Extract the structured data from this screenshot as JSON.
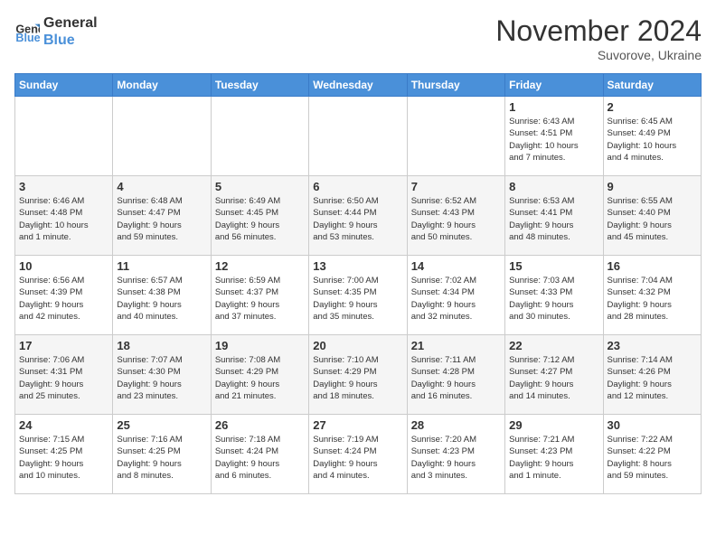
{
  "logo": {
    "line1": "General",
    "line2": "Blue"
  },
  "title": "November 2024",
  "location": "Suvorove, Ukraine",
  "days_of_week": [
    "Sunday",
    "Monday",
    "Tuesday",
    "Wednesday",
    "Thursday",
    "Friday",
    "Saturday"
  ],
  "weeks": [
    [
      {
        "day": "",
        "info": ""
      },
      {
        "day": "",
        "info": ""
      },
      {
        "day": "",
        "info": ""
      },
      {
        "day": "",
        "info": ""
      },
      {
        "day": "",
        "info": ""
      },
      {
        "day": "1",
        "info": "Sunrise: 6:43 AM\nSunset: 4:51 PM\nDaylight: 10 hours\nand 7 minutes."
      },
      {
        "day": "2",
        "info": "Sunrise: 6:45 AM\nSunset: 4:49 PM\nDaylight: 10 hours\nand 4 minutes."
      }
    ],
    [
      {
        "day": "3",
        "info": "Sunrise: 6:46 AM\nSunset: 4:48 PM\nDaylight: 10 hours\nand 1 minute."
      },
      {
        "day": "4",
        "info": "Sunrise: 6:48 AM\nSunset: 4:47 PM\nDaylight: 9 hours\nand 59 minutes."
      },
      {
        "day": "5",
        "info": "Sunrise: 6:49 AM\nSunset: 4:45 PM\nDaylight: 9 hours\nand 56 minutes."
      },
      {
        "day": "6",
        "info": "Sunrise: 6:50 AM\nSunset: 4:44 PM\nDaylight: 9 hours\nand 53 minutes."
      },
      {
        "day": "7",
        "info": "Sunrise: 6:52 AM\nSunset: 4:43 PM\nDaylight: 9 hours\nand 50 minutes."
      },
      {
        "day": "8",
        "info": "Sunrise: 6:53 AM\nSunset: 4:41 PM\nDaylight: 9 hours\nand 48 minutes."
      },
      {
        "day": "9",
        "info": "Sunrise: 6:55 AM\nSunset: 4:40 PM\nDaylight: 9 hours\nand 45 minutes."
      }
    ],
    [
      {
        "day": "10",
        "info": "Sunrise: 6:56 AM\nSunset: 4:39 PM\nDaylight: 9 hours\nand 42 minutes."
      },
      {
        "day": "11",
        "info": "Sunrise: 6:57 AM\nSunset: 4:38 PM\nDaylight: 9 hours\nand 40 minutes."
      },
      {
        "day": "12",
        "info": "Sunrise: 6:59 AM\nSunset: 4:37 PM\nDaylight: 9 hours\nand 37 minutes."
      },
      {
        "day": "13",
        "info": "Sunrise: 7:00 AM\nSunset: 4:35 PM\nDaylight: 9 hours\nand 35 minutes."
      },
      {
        "day": "14",
        "info": "Sunrise: 7:02 AM\nSunset: 4:34 PM\nDaylight: 9 hours\nand 32 minutes."
      },
      {
        "day": "15",
        "info": "Sunrise: 7:03 AM\nSunset: 4:33 PM\nDaylight: 9 hours\nand 30 minutes."
      },
      {
        "day": "16",
        "info": "Sunrise: 7:04 AM\nSunset: 4:32 PM\nDaylight: 9 hours\nand 28 minutes."
      }
    ],
    [
      {
        "day": "17",
        "info": "Sunrise: 7:06 AM\nSunset: 4:31 PM\nDaylight: 9 hours\nand 25 minutes."
      },
      {
        "day": "18",
        "info": "Sunrise: 7:07 AM\nSunset: 4:30 PM\nDaylight: 9 hours\nand 23 minutes."
      },
      {
        "day": "19",
        "info": "Sunrise: 7:08 AM\nSunset: 4:29 PM\nDaylight: 9 hours\nand 21 minutes."
      },
      {
        "day": "20",
        "info": "Sunrise: 7:10 AM\nSunset: 4:29 PM\nDaylight: 9 hours\nand 18 minutes."
      },
      {
        "day": "21",
        "info": "Sunrise: 7:11 AM\nSunset: 4:28 PM\nDaylight: 9 hours\nand 16 minutes."
      },
      {
        "day": "22",
        "info": "Sunrise: 7:12 AM\nSunset: 4:27 PM\nDaylight: 9 hours\nand 14 minutes."
      },
      {
        "day": "23",
        "info": "Sunrise: 7:14 AM\nSunset: 4:26 PM\nDaylight: 9 hours\nand 12 minutes."
      }
    ],
    [
      {
        "day": "24",
        "info": "Sunrise: 7:15 AM\nSunset: 4:25 PM\nDaylight: 9 hours\nand 10 minutes."
      },
      {
        "day": "25",
        "info": "Sunrise: 7:16 AM\nSunset: 4:25 PM\nDaylight: 9 hours\nand 8 minutes."
      },
      {
        "day": "26",
        "info": "Sunrise: 7:18 AM\nSunset: 4:24 PM\nDaylight: 9 hours\nand 6 minutes."
      },
      {
        "day": "27",
        "info": "Sunrise: 7:19 AM\nSunset: 4:24 PM\nDaylight: 9 hours\nand 4 minutes."
      },
      {
        "day": "28",
        "info": "Sunrise: 7:20 AM\nSunset: 4:23 PM\nDaylight: 9 hours\nand 3 minutes."
      },
      {
        "day": "29",
        "info": "Sunrise: 7:21 AM\nSunset: 4:23 PM\nDaylight: 9 hours\nand 1 minute."
      },
      {
        "day": "30",
        "info": "Sunrise: 7:22 AM\nSunset: 4:22 PM\nDaylight: 8 hours\nand 59 minutes."
      }
    ]
  ]
}
